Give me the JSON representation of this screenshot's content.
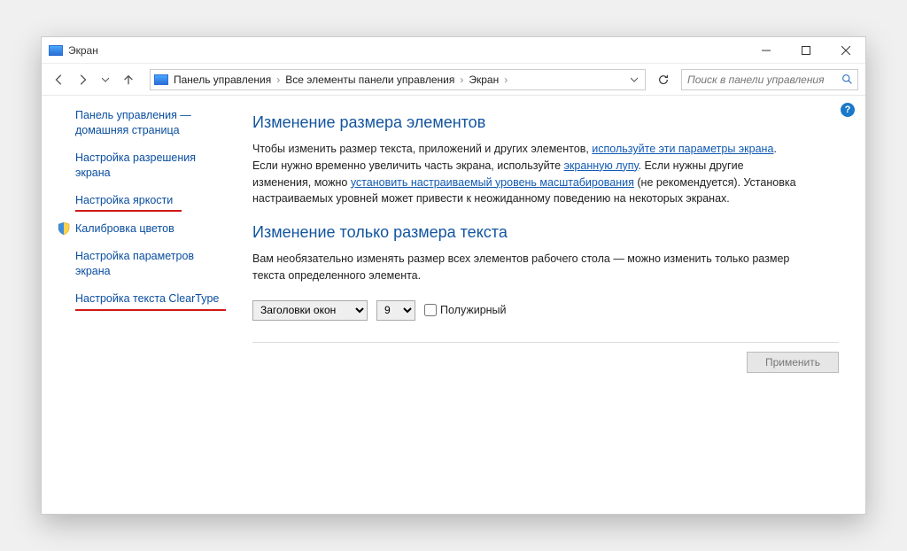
{
  "window": {
    "title": "Экран"
  },
  "breadcrumb": {
    "items": [
      "Панель управления",
      "Все элементы панели управления",
      "Экран"
    ]
  },
  "search": {
    "placeholder": "Поиск в панели управления"
  },
  "sidebar": {
    "items": [
      {
        "label": "Панель управления — домашняя страница",
        "shield": false
      },
      {
        "label": "Настройка разрешения экрана",
        "shield": false
      },
      {
        "label": "Настройка яркости",
        "shield": false,
        "annot": true,
        "annot_width": "narrow"
      },
      {
        "label": "Калибровка цветов",
        "shield": true
      },
      {
        "label": "Настройка параметров экрана",
        "shield": false
      },
      {
        "label": "Настройка текста ClearType",
        "shield": false,
        "annot": true,
        "annot_width": "wide"
      }
    ]
  },
  "main": {
    "heading1": "Изменение размера элементов",
    "para1_a": "Чтобы изменить размер текста, приложений и других элементов, ",
    "para1_link1": "используйте эти параметры экрана",
    "para1_b": ". Если нужно временно увеличить часть экрана, используйте ",
    "para1_link2": "экранную лупу",
    "para1_c": ". Если нужны другие изменения, можно ",
    "para1_link3": "установить настраиваемый уровень масштабирования",
    "para1_d": " (не рекомендуется). Установка настраиваемых уровней может привести к неожиданному поведению на некоторых экранах.",
    "heading2": "Изменение только размера текста",
    "para2": "Вам необязательно изменять размер всех элементов рабочего стола — можно изменить только размер текста определенного элемента.",
    "select_element": {
      "value": "Заголовки окон"
    },
    "select_size": {
      "value": "9"
    },
    "bold_label": "Полужирный",
    "apply": "Применить"
  },
  "help_badge": "?"
}
